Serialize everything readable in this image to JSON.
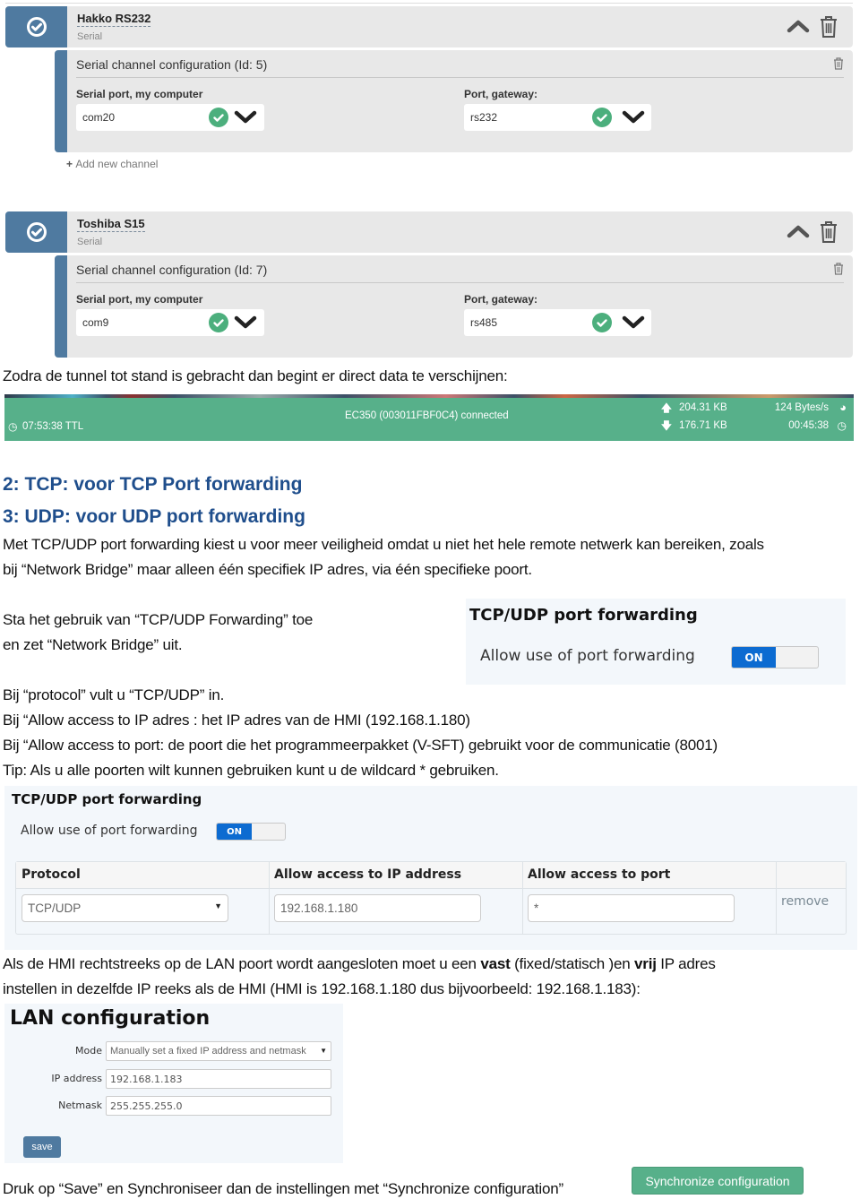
{
  "devices": [
    {
      "name": "Hakko RS232",
      "type": "Serial",
      "channel_title": "Serial channel configuration (Id: 5)",
      "serial_port_label": "Serial port, my computer",
      "serial_port_value": "com20",
      "gateway_port_label": "Port, gateway:",
      "gateway_port_value": "rs232",
      "add_channel": "Add new channel"
    },
    {
      "name": "Toshiba S15",
      "type": "Serial",
      "channel_title": "Serial channel configuration (Id: 7)",
      "serial_port_label": "Serial port, my computer",
      "serial_port_value": "com9",
      "gateway_port_label": "Port, gateway:",
      "gateway_port_value": "rs485"
    }
  ],
  "doc": {
    "p_tunnel": "Zodra de tunnel tot stand is gebracht dan begint er direct data te verschijnen:",
    "h_tcp": "2: TCP: voor TCP Port forwarding",
    "h_udp": "3: UDP: voor UDP port forwarding",
    "p_intro_1": "Met TCP/UDP port forwarding kiest u voor meer veiligheid omdat u niet het hele remote netwerk kan bereiken, zoals",
    "p_intro_2": "bij “Network Bridge” maar alleen één specifiek IP adres, via één specifieke  poort.",
    "p_allow_1": "Sta het gebruik van “TCP/UDP Forwarding” toe",
    "p_allow_2": "en zet “Network Bridge” uit.",
    "p_protocol": "Bij “protocol” vult u “TCP/UDP” in.",
    "p_ip": "Bij “Allow access to IP adres : het IP adres van de HMI (192.168.1.180)",
    "p_port": "Bij “Allow access to port:  de poort die het programmeerpakket (V-SFT) gebruikt voor de communicatie (8001)",
    "p_tip": "Tip: Als u alle poorten wilt kunnen gebruiken kunt u de wildcard * gebruiken.",
    "p_lan_1_a": "Als de HMI rechtstreeks op de LAN poort wordt aangesloten  moet u een ",
    "p_lan_1_b": "vast",
    "p_lan_1_c": " (fixed/statisch )en ",
    "p_lan_1_d": "vrij",
    "p_lan_1_e": " IP adres",
    "p_lan_2": "instellen in dezelfde  IP reeks als de HMI (HMI is 192.168.1.180 dus bijvoorbeeld: 192.168.1.183):",
    "p_save": "Druk op “Save” en Synchroniseer dan de instellingen met “Synchronize configuration”"
  },
  "status_bar": {
    "ttl": "07:53:38 TTL",
    "connection": "EC350 (003011FBF0C4) connected",
    "upload": "204.31 KB",
    "download": "176.71 KB",
    "rate": "124 Bytes/s",
    "elapsed": "00:45:38"
  },
  "port_forwarding_small": {
    "title": "TCP/UDP port forwarding",
    "allow_label": "Allow use of port forwarding",
    "toggle": "ON"
  },
  "port_forwarding": {
    "title": "TCP/UDP port forwarding",
    "allow_label": "Allow use of port forwarding",
    "toggle": "ON",
    "columns": [
      "Protocol",
      "Allow access to IP address",
      "Allow access to port",
      ""
    ],
    "row": {
      "protocol": "TCP/UDP",
      "ip": "192.168.1.180",
      "port": "*",
      "remove": "remove"
    }
  },
  "lan": {
    "title": "LAN configuration",
    "mode_label": "Mode",
    "mode_value": "Manually set a fixed IP address and netmask",
    "ip_label": "IP address",
    "ip_value": "192.168.1.183",
    "netmask_label": "Netmask",
    "netmask_value": "255.255.255.0",
    "save": "save"
  },
  "sync_button": "Synchronize configuration",
  "colors": {
    "device_blue": "#4f7aa0",
    "status_green": "#57b08a",
    "heading_blue": "#1f4e8c",
    "toggle_blue": "#0c6bd1"
  }
}
